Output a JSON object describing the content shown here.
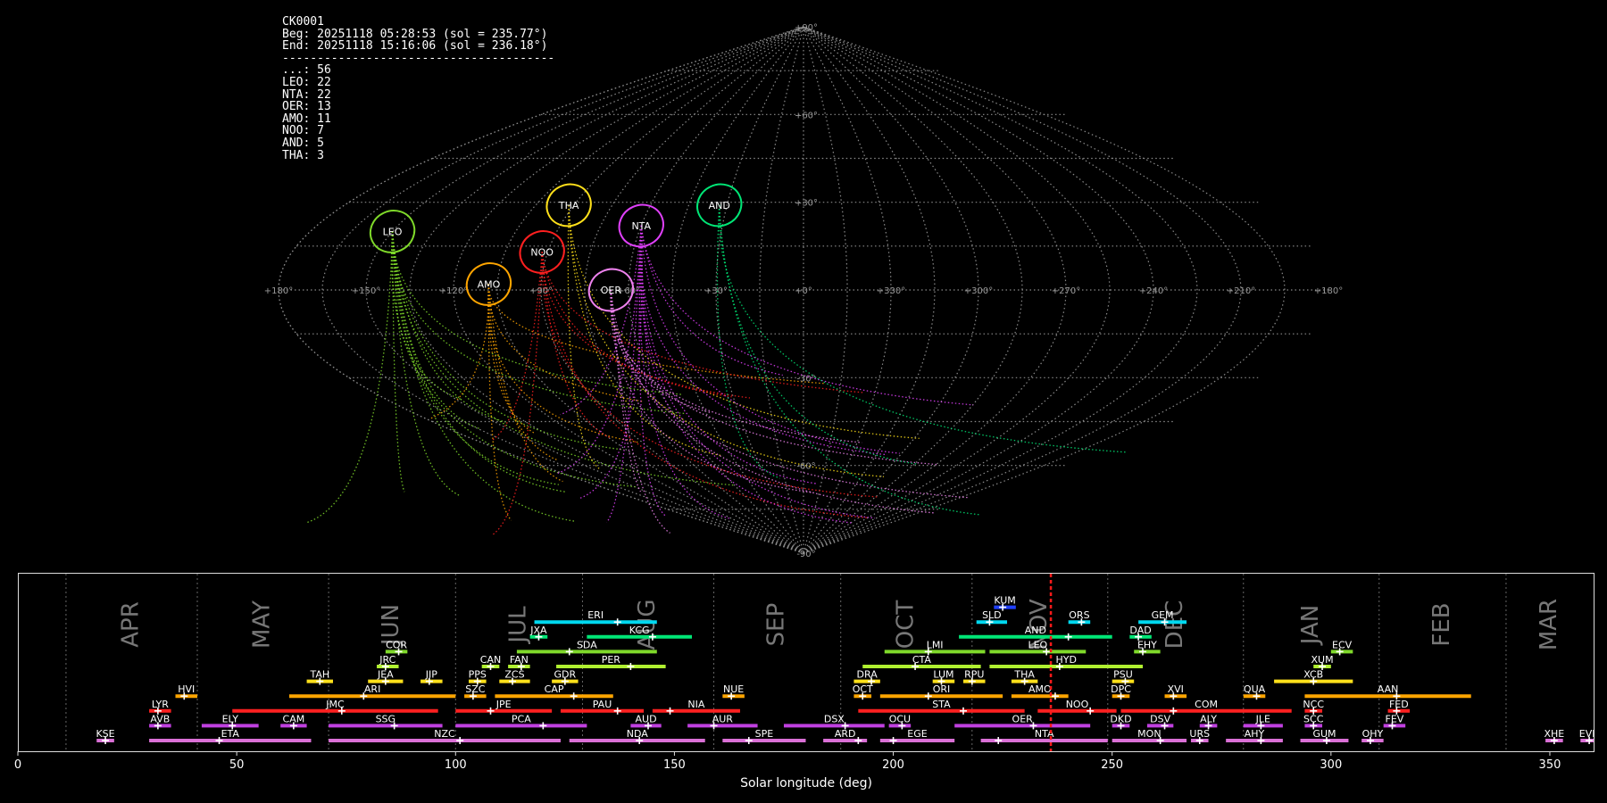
{
  "summary": {
    "camera": "CK0001",
    "beg": "Beg: 20251118 05:28:53 (sol = 235.77°)",
    "end": "End: 20251118 15:16:06 (sol = 236.18°)",
    "rule": "---------------------------------------",
    "counts": [
      {
        "code": "...",
        "n": 56
      },
      {
        "code": "LEO",
        "n": 22
      },
      {
        "code": "NTA",
        "n": 22
      },
      {
        "code": "OER",
        "n": 13
      },
      {
        "code": "AMO",
        "n": 11
      },
      {
        "code": "NOO",
        "n": 7
      },
      {
        "code": "AND",
        "n": 5
      },
      {
        "code": "THA",
        "n": 3
      }
    ]
  },
  "sky": {
    "projection": "sinusoidal",
    "lat_labels": [
      "+90°",
      "+60°",
      "+30°",
      "-30°",
      "-60°",
      "-90°"
    ],
    "lon_labels": [
      "+180°",
      "+150°",
      "+120°",
      "+90°",
      "+60°",
      "+30°",
      "+0°",
      "+330°",
      "+300°",
      "+270°",
      "+240°",
      "+210°",
      "+180°"
    ],
    "radiants": [
      {
        "name": "LEO",
        "lon": 150,
        "lat": 20,
        "color": "#7fd92a"
      },
      {
        "name": "AMO",
        "lon": 108,
        "lat": 2,
        "color": "#ffa500"
      },
      {
        "name": "THA",
        "lon": 92,
        "lat": 29,
        "color": "#ffe01a"
      },
      {
        "name": "NOO",
        "lon": 92,
        "lat": 13,
        "color": "#ff2020"
      },
      {
        "name": "NTA",
        "lon": 60,
        "lat": 22,
        "color": "#e040fb"
      },
      {
        "name": "OER",
        "lon": 66,
        "lat": 0,
        "color": "#ee82ee"
      },
      {
        "name": "AND",
        "lon": 33,
        "lat": 29,
        "color": "#00e676"
      }
    ]
  },
  "chart_data": {
    "type": "timeline",
    "xlabel": "Solar longitude (deg)",
    "xlim": [
      0,
      360
    ],
    "xticks": [
      0,
      50,
      100,
      150,
      200,
      250,
      300,
      350
    ],
    "month_starts": [
      11,
      41,
      71,
      100,
      129,
      159,
      188,
      218,
      249,
      280,
      311,
      340
    ],
    "months": [
      "APR",
      "MAY",
      "JUN",
      "JUL",
      "AUG",
      "SEP",
      "OCT",
      "NOV",
      "DEC",
      "JAN",
      "FEB",
      "MAR"
    ],
    "current_sol": 236,
    "showers": [
      {
        "code": "KSE",
        "start": 18,
        "end": 22,
        "peak": 20,
        "row": 0,
        "color": "#da70d6"
      },
      {
        "code": "ETA",
        "start": 30,
        "end": 67,
        "peak": 46,
        "row": 0,
        "color": "#da70d6"
      },
      {
        "code": "NZC",
        "start": 71,
        "end": 124,
        "peak": 101,
        "row": 0,
        "color": "#da70d6"
      },
      {
        "code": "NDA",
        "start": 126,
        "end": 157,
        "peak": 142,
        "row": 0,
        "color": "#da70d6"
      },
      {
        "code": "SPE",
        "start": 161,
        "end": 180,
        "peak": 167,
        "row": 0,
        "color": "#da70d6"
      },
      {
        "code": "ARD",
        "start": 184,
        "end": 194,
        "peak": 192,
        "row": 0,
        "color": "#da70d6"
      },
      {
        "code": "EGE",
        "start": 197,
        "end": 214,
        "peak": 200,
        "row": 0,
        "color": "#da70d6"
      },
      {
        "code": "NTA",
        "start": 220,
        "end": 249,
        "peak": 224,
        "row": 0,
        "color": "#da70d6"
      },
      {
        "code": "MON",
        "start": 250,
        "end": 267,
        "peak": 261,
        "row": 0,
        "color": "#da70d6"
      },
      {
        "code": "URS",
        "start": 268,
        "end": 272,
        "peak": 270,
        "row": 0,
        "color": "#da70d6"
      },
      {
        "code": "AHY",
        "start": 276,
        "end": 289,
        "peak": 284,
        "row": 0,
        "color": "#da70d6"
      },
      {
        "code": "GUM",
        "start": 293,
        "end": 304,
        "peak": 299,
        "row": 0,
        "color": "#da70d6"
      },
      {
        "code": "OHY",
        "start": 307,
        "end": 312,
        "peak": 309,
        "row": 0,
        "color": "#da70d6"
      },
      {
        "code": "XHE",
        "start": 349,
        "end": 353,
        "peak": 351,
        "row": 0,
        "color": "#da70d6"
      },
      {
        "code": "EVI",
        "start": 357,
        "end": 361,
        "peak": 359,
        "row": 0,
        "color": "#da70d6"
      },
      {
        "code": "AVB",
        "start": 30,
        "end": 35,
        "peak": 32,
        "row": 1,
        "color": "#c040e0"
      },
      {
        "code": "ELY",
        "start": 42,
        "end": 55,
        "peak": 49,
        "row": 1,
        "color": "#c040e0"
      },
      {
        "code": "CAM",
        "start": 60,
        "end": 66,
        "peak": 63,
        "row": 1,
        "color": "#c040e0"
      },
      {
        "code": "SSG",
        "start": 71,
        "end": 97,
        "peak": 86,
        "row": 1,
        "color": "#c040e0"
      },
      {
        "code": "PCA",
        "start": 100,
        "end": 130,
        "peak": 120,
        "row": 1,
        "color": "#c040e0"
      },
      {
        "code": "AUD",
        "start": 140,
        "end": 147,
        "peak": 144,
        "row": 1,
        "color": "#c040e0"
      },
      {
        "code": "AUR",
        "start": 153,
        "end": 169,
        "peak": 159,
        "row": 1,
        "color": "#c040e0"
      },
      {
        "code": "DSX",
        "start": 175,
        "end": 198,
        "peak": 189,
        "row": 1,
        "color": "#c040e0"
      },
      {
        "code": "OCU",
        "start": 199,
        "end": 204,
        "peak": 202,
        "row": 1,
        "color": "#c040e0"
      },
      {
        "code": "OER",
        "start": 214,
        "end": 245,
        "peak": 232,
        "row": 1,
        "color": "#c040e0"
      },
      {
        "code": "DKD",
        "start": 250,
        "end": 254,
        "peak": 252,
        "row": 1,
        "color": "#c040e0"
      },
      {
        "code": "DSV",
        "start": 258,
        "end": 264,
        "peak": 262,
        "row": 1,
        "color": "#c040e0"
      },
      {
        "code": "ALY",
        "start": 270,
        "end": 274,
        "peak": 272,
        "row": 1,
        "color": "#c040e0"
      },
      {
        "code": "JLE",
        "start": 280,
        "end": 289,
        "peak": 284,
        "row": 1,
        "color": "#c040e0"
      },
      {
        "code": "SCC",
        "start": 294,
        "end": 298,
        "peak": 296,
        "row": 1,
        "color": "#c040e0"
      },
      {
        "code": "FEV",
        "start": 312,
        "end": 317,
        "peak": 314,
        "row": 1,
        "color": "#c040e0"
      },
      {
        "code": "LYR",
        "start": 30,
        "end": 35,
        "peak": 32,
        "row": 2,
        "color": "#ff2020"
      },
      {
        "code": "JMC",
        "start": 49,
        "end": 96,
        "peak": 74,
        "row": 2,
        "color": "#ff2020"
      },
      {
        "code": "JPE",
        "start": 100,
        "end": 122,
        "peak": 108,
        "row": 2,
        "color": "#ff2020"
      },
      {
        "code": "PAU",
        "start": 124,
        "end": 143,
        "peak": 137,
        "row": 2,
        "color": "#ff2020"
      },
      {
        "code": "NIA",
        "start": 145,
        "end": 165,
        "peak": 149,
        "row": 2,
        "color": "#ff2020"
      },
      {
        "code": "STA",
        "start": 192,
        "end": 230,
        "peak": 216,
        "row": 2,
        "color": "#ff2020"
      },
      {
        "code": "NOO",
        "start": 233,
        "end": 251,
        "peak": 245,
        "row": 2,
        "color": "#ff2020"
      },
      {
        "code": "COM",
        "start": 252,
        "end": 291,
        "peak": 264,
        "row": 2,
        "color": "#ff2020"
      },
      {
        "code": "NCC",
        "start": 294,
        "end": 298,
        "peak": 296,
        "row": 2,
        "color": "#ff2020"
      },
      {
        "code": "FED",
        "start": 313,
        "end": 318,
        "peak": 315,
        "row": 2,
        "color": "#ff2020"
      },
      {
        "code": "HVI",
        "start": 36,
        "end": 41,
        "peak": 38,
        "row": 3,
        "color": "#ffa500"
      },
      {
        "code": "ARI",
        "start": 62,
        "end": 100,
        "peak": 79,
        "row": 3,
        "color": "#ffa500"
      },
      {
        "code": "SZC",
        "start": 102,
        "end": 107,
        "peak": 104,
        "row": 3,
        "color": "#ffa500"
      },
      {
        "code": "CAP",
        "start": 109,
        "end": 136,
        "peak": 127,
        "row": 3,
        "color": "#ffa500"
      },
      {
        "code": "NUE",
        "start": 161,
        "end": 166,
        "peak": 163,
        "row": 3,
        "color": "#ffa500"
      },
      {
        "code": "OCT",
        "start": 191,
        "end": 195,
        "peak": 193,
        "row": 3,
        "color": "#ffa500"
      },
      {
        "code": "ORI",
        "start": 197,
        "end": 225,
        "peak": 208,
        "row": 3,
        "color": "#ffa500"
      },
      {
        "code": "AMO",
        "start": 227,
        "end": 240,
        "peak": 237,
        "row": 3,
        "color": "#ffa500"
      },
      {
        "code": "DPC",
        "start": 250,
        "end": 254,
        "peak": 252,
        "row": 3,
        "color": "#ffa500"
      },
      {
        "code": "XVI",
        "start": 262,
        "end": 267,
        "peak": 264,
        "row": 3,
        "color": "#ffa500"
      },
      {
        "code": "QUA",
        "start": 280,
        "end": 285,
        "peak": 283,
        "row": 3,
        "color": "#ffa500"
      },
      {
        "code": "AAN",
        "start": 294,
        "end": 332,
        "peak": 315,
        "row": 3,
        "color": "#ffa500"
      },
      {
        "code": "TAH",
        "start": 66,
        "end": 72,
        "peak": 69,
        "row": 4,
        "color": "#ffe01a"
      },
      {
        "code": "JEA",
        "start": 80,
        "end": 88,
        "peak": 84,
        "row": 4,
        "color": "#ffe01a"
      },
      {
        "code": "JIP",
        "start": 92,
        "end": 97,
        "peak": 94,
        "row": 4,
        "color": "#ffe01a"
      },
      {
        "code": "PPS",
        "start": 103,
        "end": 107,
        "peak": 105,
        "row": 4,
        "color": "#ffe01a"
      },
      {
        "code": "ZCS",
        "start": 110,
        "end": 117,
        "peak": 113,
        "row": 4,
        "color": "#ffe01a"
      },
      {
        "code": "GDR",
        "start": 122,
        "end": 128,
        "peak": 125,
        "row": 4,
        "color": "#ffe01a"
      },
      {
        "code": "DRA",
        "start": 191,
        "end": 197,
        "peak": 195,
        "row": 4,
        "color": "#ffe01a"
      },
      {
        "code": "LUM",
        "start": 209,
        "end": 214,
        "peak": 211,
        "row": 4,
        "color": "#ffe01a"
      },
      {
        "code": "RPU",
        "start": 216,
        "end": 221,
        "peak": 218,
        "row": 4,
        "color": "#ffe01a"
      },
      {
        "code": "THA",
        "start": 227,
        "end": 233,
        "peak": 230,
        "row": 4,
        "color": "#ffe01a"
      },
      {
        "code": "PSU",
        "start": 250,
        "end": 255,
        "peak": 253,
        "row": 4,
        "color": "#ffe01a"
      },
      {
        "code": "XCB",
        "start": 287,
        "end": 305,
        "peak": 296,
        "row": 4,
        "color": "#ffe01a"
      },
      {
        "code": "JRC",
        "start": 82,
        "end": 87,
        "peak": 84,
        "row": 5,
        "color": "#b0f030"
      },
      {
        "code": "CAN",
        "start": 106,
        "end": 110,
        "peak": 108,
        "row": 5,
        "color": "#b0f030"
      },
      {
        "code": "FAN",
        "start": 112,
        "end": 117,
        "peak": 115,
        "row": 5,
        "color": "#b0f030"
      },
      {
        "code": "PER",
        "start": 123,
        "end": 148,
        "peak": 140,
        "row": 5,
        "color": "#b0f030"
      },
      {
        "code": "CTA",
        "start": 193,
        "end": 220,
        "peak": 205,
        "row": 5,
        "color": "#b0f030"
      },
      {
        "code": "HYD",
        "start": 222,
        "end": 257,
        "peak": 238,
        "row": 5,
        "color": "#b0f030"
      },
      {
        "code": "XUM",
        "start": 296,
        "end": 300,
        "peak": 298,
        "row": 5,
        "color": "#b0f030"
      },
      {
        "code": "COR",
        "start": 84,
        "end": 89,
        "peak": 87,
        "row": 6,
        "color": "#7fd92a"
      },
      {
        "code": "SDA",
        "start": 114,
        "end": 146,
        "peak": 126,
        "row": 6,
        "color": "#7fd92a"
      },
      {
        "code": "LMI",
        "start": 198,
        "end": 221,
        "peak": 208,
        "row": 6,
        "color": "#7fd92a"
      },
      {
        "code": "LEO",
        "start": 222,
        "end": 244,
        "peak": 235,
        "row": 6,
        "color": "#7fd92a"
      },
      {
        "code": "EHY",
        "start": 255,
        "end": 261,
        "peak": 257,
        "row": 6,
        "color": "#7fd92a"
      },
      {
        "code": "ECV",
        "start": 300,
        "end": 305,
        "peak": 302,
        "row": 6,
        "color": "#7fd92a"
      },
      {
        "code": "JXA",
        "start": 117,
        "end": 121,
        "peak": 119,
        "row": 7,
        "color": "#00e676"
      },
      {
        "code": "KCG",
        "start": 130,
        "end": 154,
        "peak": 145,
        "row": 7,
        "color": "#00e676"
      },
      {
        "code": "AND",
        "start": 215,
        "end": 250,
        "peak": 240,
        "row": 7,
        "color": "#00e676"
      },
      {
        "code": "DAD",
        "start": 254,
        "end": 259,
        "peak": 256,
        "row": 7,
        "color": "#00e676"
      },
      {
        "code": "ERI",
        "start": 118,
        "end": 146,
        "peak": 137,
        "row": 8,
        "color": "#00d8f0"
      },
      {
        "code": "SLD",
        "start": 219,
        "end": 226,
        "peak": 222,
        "row": 8,
        "color": "#00d8f0"
      },
      {
        "code": "ORS",
        "start": 240,
        "end": 245,
        "peak": 243,
        "row": 8,
        "color": "#00d8f0"
      },
      {
        "code": "GEM",
        "start": 256,
        "end": 267,
        "peak": 262,
        "row": 8,
        "color": "#00d8f0"
      },
      {
        "code": "KUM",
        "start": 223,
        "end": 228,
        "peak": 225,
        "row": 9,
        "color": "#2040ff"
      }
    ]
  }
}
